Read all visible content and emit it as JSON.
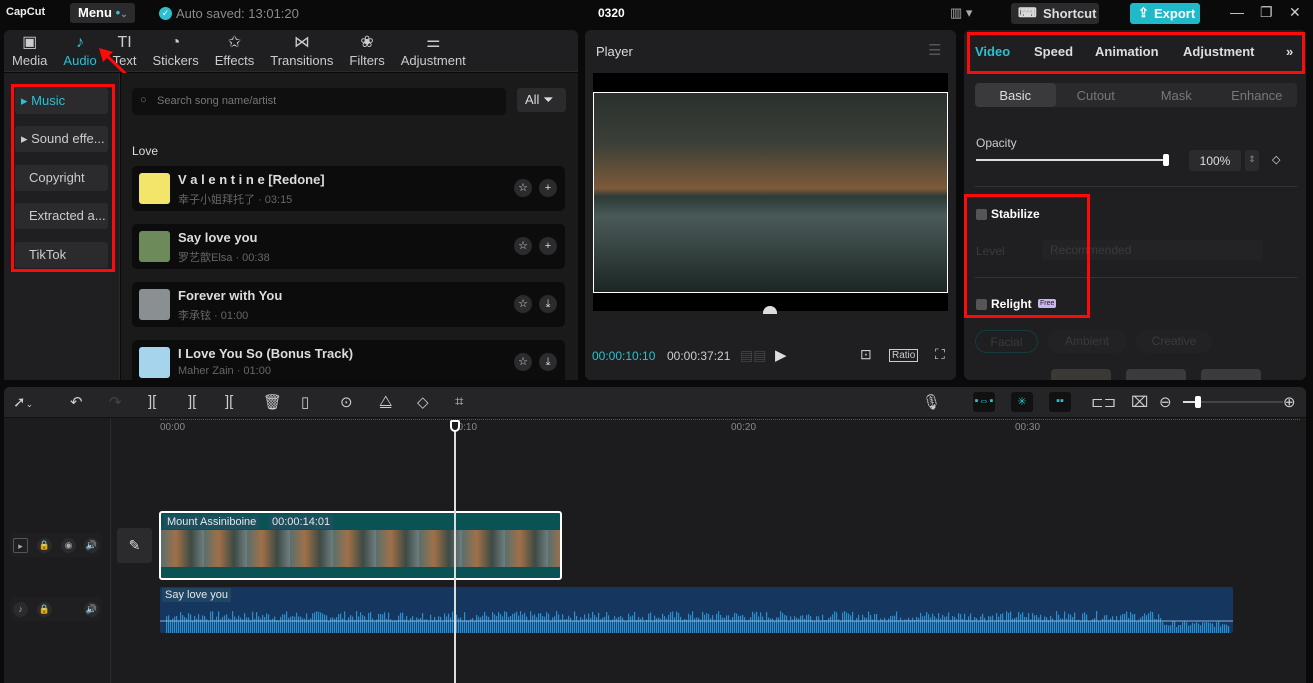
{
  "app": {
    "logo": "CapCut",
    "menu": "Menu",
    "saved": "Auto saved: 13:01:20",
    "title": "0320",
    "shortcut": "Shortcut",
    "export": "Export"
  },
  "tabs": [
    {
      "label": "Media",
      "icon": "▣"
    },
    {
      "label": "Audio",
      "icon": "♪"
    },
    {
      "label": "Text",
      "icon": "TI"
    },
    {
      "label": "Stickers",
      "icon": "◔"
    },
    {
      "label": "Effects",
      "icon": "✩"
    },
    {
      "label": "Transitions",
      "icon": "⋈"
    },
    {
      "label": "Filters",
      "icon": "❀"
    },
    {
      "label": "Adjustment",
      "icon": "⚌"
    }
  ],
  "sidebar": [
    "Music",
    "Sound effe...",
    "Copyright",
    "Extracted a...",
    "TikTok"
  ],
  "search": {
    "placeholder": "Search song name/artist",
    "filter": "All"
  },
  "section": "Love",
  "songs": [
    {
      "title": "V a l e n t i n e  [Redone]",
      "meta": "幸子小姐拜托了 · 03:15",
      "action": "+"
    },
    {
      "title": "Say love you",
      "meta": "罗艺歆Elsa · 00:38",
      "action": "+"
    },
    {
      "title": "Forever with You",
      "meta": "李承铉 · 01:00",
      "action": "⤓"
    },
    {
      "title": "I Love You So (Bonus Track)",
      "meta": "Maher Zain · 01:00",
      "action": "⤓"
    }
  ],
  "player": {
    "title": "Player",
    "current": "00:00:10:10",
    "total": "00:00:37:21",
    "ratio": "Ratio"
  },
  "right": {
    "tabs": [
      "Video",
      "Speed",
      "Animation",
      "Adjustment"
    ],
    "subtabs": [
      "Basic",
      "Cutout",
      "Mask",
      "Enhance"
    ],
    "opacity_label": "Opacity",
    "opacity": "100%",
    "opacity_value": 100,
    "stabilize": "Stabilize",
    "level": "Level",
    "level_value": "Recommended",
    "relight": "Relight",
    "free": "Free",
    "relight_modes": [
      "Facial",
      "Ambient",
      "Creative"
    ]
  },
  "timeline": {
    "ruler": [
      "00:00",
      "00:10",
      "00:20",
      "00:30"
    ],
    "clip_name": "Mount Assiniboine",
    "clip_duration": "00:00:14:01",
    "audio_name": "Say love you",
    "zoom_level": 0.15
  },
  "colors": {
    "accent": "#2cc0d0",
    "highlight": "#ff0a0a"
  }
}
